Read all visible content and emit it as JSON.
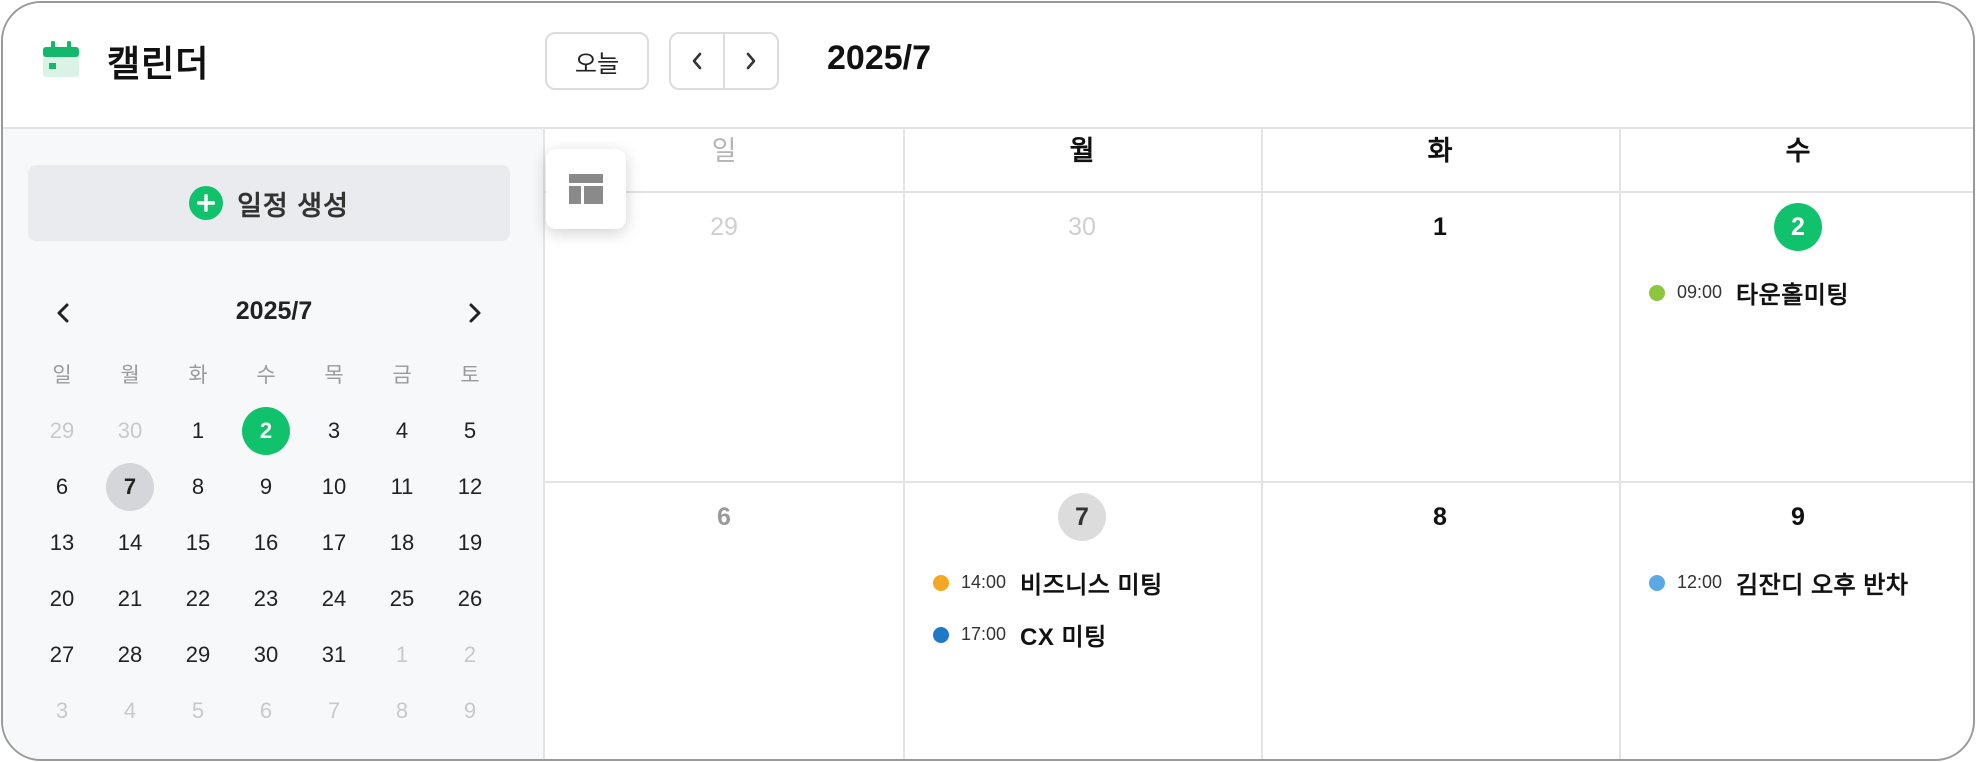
{
  "app": {
    "title": "캘린더"
  },
  "toolbar": {
    "today_label": "오늘",
    "month_title": "2025/7"
  },
  "sidebar": {
    "create_label": "일정 생성",
    "mini_title": "2025/7",
    "weekdays": [
      "일",
      "월",
      "화",
      "수",
      "목",
      "금",
      "토"
    ],
    "weeks": [
      [
        "29",
        "30",
        "1",
        "2",
        "3",
        "4",
        "5"
      ],
      [
        "6",
        "7",
        "8",
        "9",
        "10",
        "11",
        "12"
      ],
      [
        "13",
        "14",
        "15",
        "16",
        "17",
        "18",
        "19"
      ],
      [
        "20",
        "21",
        "22",
        "23",
        "24",
        "25",
        "26"
      ],
      [
        "27",
        "28",
        "29",
        "30",
        "31",
        "1",
        "2"
      ],
      [
        "3",
        "4",
        "5",
        "6",
        "7",
        "8",
        "9"
      ]
    ],
    "today": "2",
    "selected": "7"
  },
  "main": {
    "weekdays": [
      "일",
      "월",
      "화",
      "수"
    ],
    "rows": [
      {
        "days": [
          "29",
          "30",
          "1",
          "2"
        ]
      },
      {
        "days": [
          "6",
          "7",
          "8",
          "9"
        ]
      }
    ],
    "events": {
      "wed_row1": {
        "time": "09:00",
        "title": "타운홀미팅",
        "color": "#8cc63f"
      },
      "mon_row2_a": {
        "time": "14:00",
        "title": "비즈니스 미팅",
        "color": "#f5a623"
      },
      "mon_row2_b": {
        "time": "17:00",
        "title": "CX 미팅",
        "color": "#1f78c8"
      },
      "thu_row2": {
        "time": "12:00",
        "title": "김잔디 오후 반차",
        "color": "#5aa9e6"
      }
    }
  },
  "colors": {
    "accent": "#10c26b"
  },
  "icons": {
    "logo": "calendar-icon",
    "view": "layout-icon",
    "create": "plus-circle-icon"
  }
}
